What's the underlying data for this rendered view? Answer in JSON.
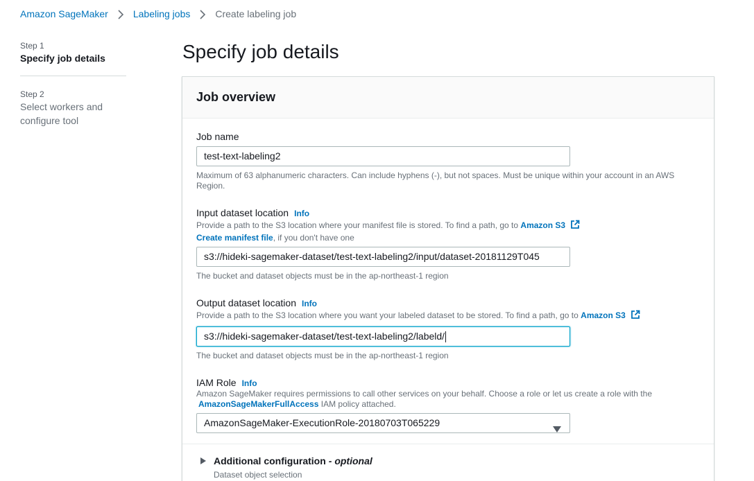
{
  "breadcrumb": {
    "items": [
      "Amazon SageMaker",
      "Labeling jobs"
    ],
    "current": "Create labeling job"
  },
  "steps": [
    {
      "num": "Step 1",
      "title": "Specify job details"
    },
    {
      "num": "Step 2",
      "title": "Select workers and configure tool"
    }
  ],
  "page_title": "Specify job details",
  "panel": {
    "title": "Job overview",
    "job_name": {
      "label": "Job name",
      "value": "test-text-labeling2",
      "hint": "Maximum of 63 alphanumeric characters. Can include hyphens (-), but not spaces. Must be unique within your account in an AWS Region."
    },
    "input_location": {
      "label": "Input dataset location",
      "info": "Info",
      "desc": "Provide a path to the S3 location where your manifest file is stored. To find a path, go to",
      "desc_link": "Amazon S3",
      "manifest_link": "Create manifest file",
      "manifest_suffix": ", if you don't have one",
      "value": "s3://hideki-sagemaker-dataset/test-text-labeling2/input/dataset-20181129T045",
      "hint": "The bucket and dataset objects must be in the ap-northeast-1 region"
    },
    "output_location": {
      "label": "Output dataset location",
      "info": "Info",
      "desc": "Provide a path to the S3 location where you want your labeled dataset to be stored. To find a path, go to",
      "desc_link": "Amazon S3",
      "value": "s3://hideki-sagemaker-dataset/test-text-labeling2/labeld/",
      "hint": "The bucket and dataset objects must be in the ap-northeast-1 region"
    },
    "iam_role": {
      "label": "IAM Role",
      "info": "Info",
      "desc": "Amazon SageMaker requires permissions to call other services on your behalf. Choose a role or let us create a role with the",
      "policy_link": "AmazonSageMakerFullAccess",
      "policy_suffix": "IAM policy attached.",
      "selected": "AmazonSageMaker-ExecutionRole-20180703T065229"
    },
    "additional": {
      "title": "Additional configuration",
      "optional": "- optional",
      "sub": "Dataset object selection"
    }
  },
  "colors": {
    "link": "#0073bb",
    "focus": "#00a1c9",
    "border": "#aab7b8"
  },
  "icons": {
    "external": "external-link-icon",
    "chevron": "chevron-right-icon",
    "dropdown": "caret-down-icon",
    "expand": "caret-right-icon"
  }
}
